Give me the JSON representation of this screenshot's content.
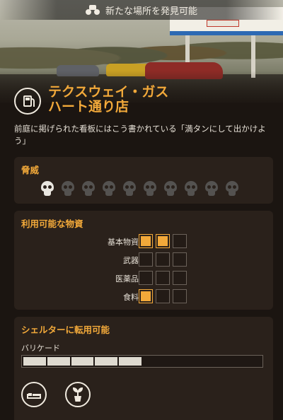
{
  "banner": {
    "text": "新たな場所を発見可能",
    "icon": "binoculars-icon"
  },
  "location": {
    "icon": "gas-pump-icon",
    "title_line1": "テクスウェイ・ガス",
    "title_line2": "ハート通り店",
    "description": "前庭に掲げられた看板にはこう書かれている「満タンにして出かけよう」"
  },
  "threat": {
    "title": "脅威",
    "level": 1,
    "max": 10
  },
  "resources": {
    "title": "利用可能な物資",
    "items": [
      {
        "label": "基本物資",
        "amount": 2,
        "max": 3
      },
      {
        "label": "武器",
        "amount": 0,
        "max": 3
      },
      {
        "label": "医薬品",
        "amount": 0,
        "max": 3
      },
      {
        "label": "食料",
        "amount": 1,
        "max": 3
      }
    ]
  },
  "shelter": {
    "title": "シェルターに転用可能",
    "barricade_label": "バリケード",
    "barricade_level": 5,
    "barricade_max": 10,
    "facilities": [
      "bed-icon",
      "plant-icon"
    ]
  },
  "colors": {
    "accent": "#f2a93a",
    "panel": "#2a211b",
    "background": "#1b1511"
  }
}
